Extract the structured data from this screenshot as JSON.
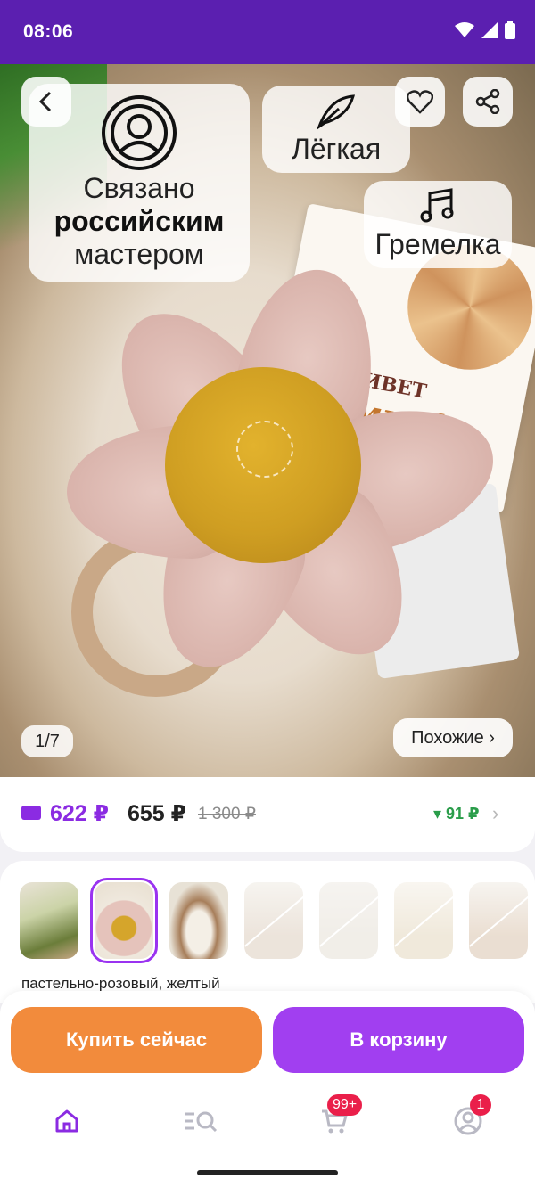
{
  "status_bar": {
    "time": "08:06",
    "icons": [
      "wifi-icon",
      "signal-icon",
      "battery-icon"
    ]
  },
  "product_image": {
    "badges": {
      "master": {
        "line1": "Связано",
        "line2": "российским",
        "line3": "мастером",
        "icon": "master-icon"
      },
      "difficulty": {
        "label": "Лёгкая",
        "icon": "feather-icon"
      },
      "type": {
        "label": "Гремелка",
        "icon": "music-notes-icon"
      }
    },
    "counter": "1/7",
    "similar_label": "Похожие ›"
  },
  "price": {
    "wallet_price": "622 ₽",
    "price": "655 ₽",
    "old_price": "1 300 ₽",
    "cashback": "▾ 91 ₽",
    "colors": {
      "wallet": "#8b2be2",
      "cashback": "#2a9d4a"
    }
  },
  "variants": {
    "color_text": "пастельно-розовый, желтый",
    "thumbnails": [
      {
        "state": "available"
      },
      {
        "state": "selected"
      },
      {
        "state": "available"
      },
      {
        "state": "unavailable"
      },
      {
        "state": "unavailable"
      },
      {
        "state": "unavailable"
      },
      {
        "state": "unavailable"
      }
    ]
  },
  "actions": {
    "buy_now": "Купить сейчас",
    "to_cart": "В корзину",
    "colors": {
      "buy_now": "#f28b3c",
      "to_cart": "#a13ff0"
    }
  },
  "nav": {
    "items": [
      {
        "name": "home",
        "icon": "home-icon"
      },
      {
        "name": "catalog",
        "icon": "catalog-search-icon"
      },
      {
        "name": "cart",
        "icon": "cart-icon",
        "badge": "99+"
      },
      {
        "name": "profile",
        "icon": "profile-icon",
        "badge": "1"
      }
    ],
    "accent": "#8b2be2"
  }
}
